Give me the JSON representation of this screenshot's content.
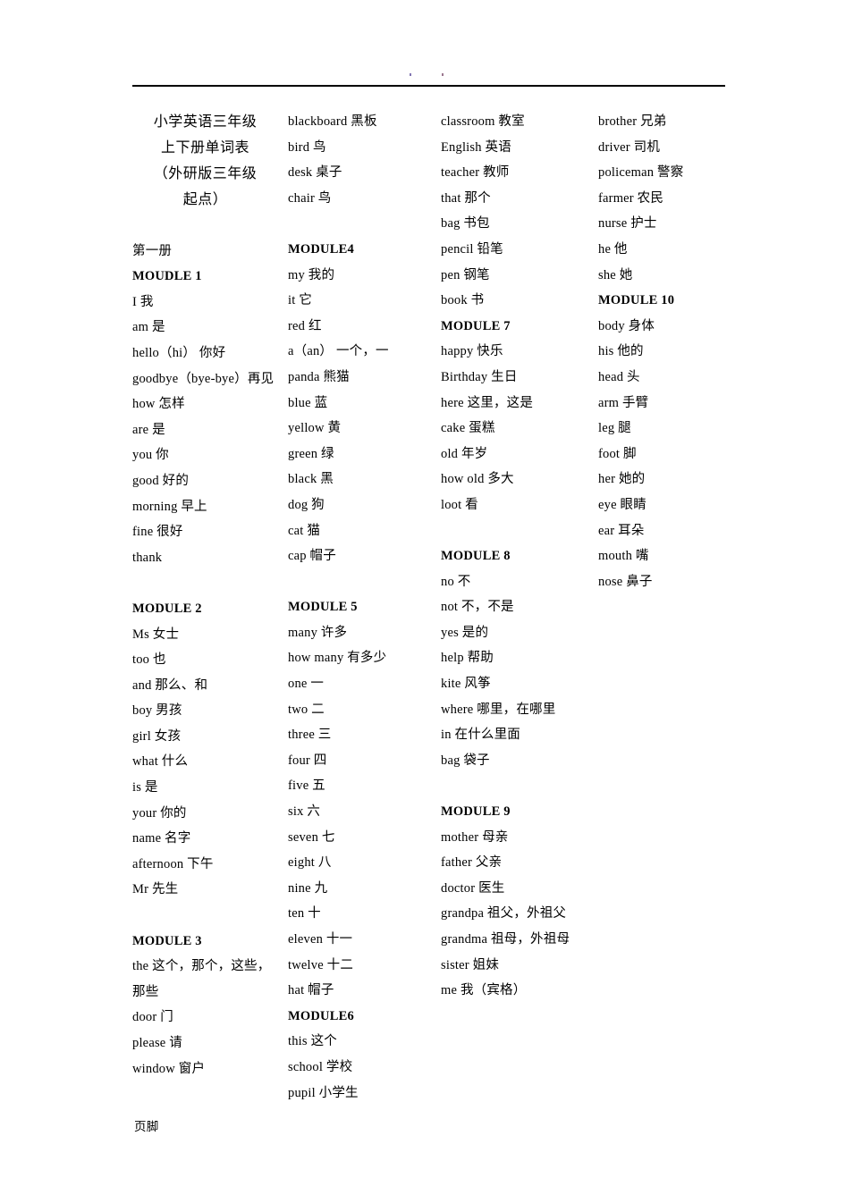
{
  "document": {
    "header": {
      "marks": 2
    },
    "footer_label": "页脚",
    "title_lines": [
      "小学英语三年级",
      "上下册单词表",
      "（外研版三年级",
      "起点）"
    ],
    "volume_label": "第一册"
  },
  "columns": [
    {
      "id": "column-1",
      "blocks": [
        {
          "type": "title"
        },
        {
          "type": "gap"
        },
        {
          "type": "volume"
        },
        {
          "type": "module",
          "label": "MOUDLE 1"
        },
        {
          "type": "entry",
          "text": "I 我"
        },
        {
          "type": "entry",
          "text": "am 是"
        },
        {
          "type": "entry",
          "text": "hello（hi） 你好"
        },
        {
          "type": "entry",
          "text": "goodbye（bye-bye）再见"
        },
        {
          "type": "entry",
          "text": "how 怎样"
        },
        {
          "type": "entry",
          "text": "are 是"
        },
        {
          "type": "entry",
          "text": "you 你"
        },
        {
          "type": "entry",
          "text": "good 好的"
        },
        {
          "type": "entry",
          "text": "morning 早上"
        },
        {
          "type": "entry",
          "text": "fine 很好"
        },
        {
          "type": "entry",
          "text": "thank"
        },
        {
          "type": "gap"
        },
        {
          "type": "module",
          "label": "MODULE 2"
        },
        {
          "type": "entry",
          "text": "Ms 女士"
        },
        {
          "type": "entry",
          "text": "too 也"
        },
        {
          "type": "entry",
          "text": "and 那么、和"
        },
        {
          "type": "entry",
          "text": "boy 男孩"
        },
        {
          "type": "entry",
          "text": "girl 女孩"
        },
        {
          "type": "entry",
          "text": "what 什么"
        },
        {
          "type": "entry",
          "text": "is 是"
        },
        {
          "type": "entry",
          "text": "your 你的"
        },
        {
          "type": "entry",
          "text": "name 名字"
        },
        {
          "type": "entry",
          "text": "afternoon 下午"
        },
        {
          "type": "entry",
          "text": "Mr 先生"
        },
        {
          "type": "gap"
        },
        {
          "type": "module",
          "label": "MODULE 3"
        },
        {
          "type": "entry",
          "text": "the 这个，那个，这些，那些"
        },
        {
          "type": "entry",
          "text": "door 门"
        },
        {
          "type": "entry",
          "text": "please 请"
        },
        {
          "type": "entry",
          "text": "window 窗户"
        }
      ]
    },
    {
      "id": "column-2",
      "blocks": [
        {
          "type": "entry",
          "text": "blackboard 黑板"
        },
        {
          "type": "entry",
          "text": "bird 鸟"
        },
        {
          "type": "entry",
          "text": "desk 桌子"
        },
        {
          "type": "entry",
          "text": "chair 鸟"
        },
        {
          "type": "gap"
        },
        {
          "type": "module",
          "label": "MODULE4"
        },
        {
          "type": "entry",
          "text": "my 我的"
        },
        {
          "type": "entry",
          "text": "it 它"
        },
        {
          "type": "entry",
          "text": "red 红"
        },
        {
          "type": "entry",
          "text": "a（an） 一个，一"
        },
        {
          "type": "entry",
          "text": "panda 熊猫"
        },
        {
          "type": "entry",
          "text": "blue 蓝"
        },
        {
          "type": "entry",
          "text": "yellow 黄"
        },
        {
          "type": "entry",
          "text": "green 绿"
        },
        {
          "type": "entry",
          "text": "black 黑"
        },
        {
          "type": "entry",
          "text": "dog 狗"
        },
        {
          "type": "entry",
          "text": "cat 猫"
        },
        {
          "type": "entry",
          "text": "cap 帽子"
        },
        {
          "type": "gap"
        },
        {
          "type": "module",
          "label": "MODULE 5"
        },
        {
          "type": "entry",
          "text": "many 许多"
        },
        {
          "type": "entry",
          "text": "how many 有多少"
        },
        {
          "type": "entry",
          "text": "one 一"
        },
        {
          "type": "entry",
          "text": "two 二"
        },
        {
          "type": "entry",
          "text": "three 三"
        },
        {
          "type": "entry",
          "text": "four 四"
        },
        {
          "type": "entry",
          "text": "five 五"
        },
        {
          "type": "entry",
          "text": "six 六"
        },
        {
          "type": "entry",
          "text": "seven 七"
        },
        {
          "type": "entry",
          "text": "eight 八"
        },
        {
          "type": "entry",
          "text": "nine 九"
        },
        {
          "type": "entry",
          "text": "ten 十"
        },
        {
          "type": "entry",
          "text": "eleven 十一"
        },
        {
          "type": "entry",
          "text": "twelve 十二"
        },
        {
          "type": "entry",
          "text": "hat 帽子"
        },
        {
          "type": "module",
          "label": "MODULE6"
        },
        {
          "type": "entry",
          "text": "this 这个"
        },
        {
          "type": "entry",
          "text": "school 学校"
        },
        {
          "type": "entry",
          "text": "pupil 小学生"
        }
      ]
    },
    {
      "id": "column-3",
      "blocks": [
        {
          "type": "entry",
          "text": "classroom 教室"
        },
        {
          "type": "entry",
          "text": "English 英语"
        },
        {
          "type": "entry",
          "text": "teacher 教师"
        },
        {
          "type": "entry",
          "text": "that 那个"
        },
        {
          "type": "entry",
          "text": "bag 书包"
        },
        {
          "type": "entry",
          "text": "pencil 铅笔"
        },
        {
          "type": "entry",
          "text": "pen 钢笔"
        },
        {
          "type": "entry",
          "text": "book 书"
        },
        {
          "type": "module",
          "label": "MODULE 7"
        },
        {
          "type": "entry",
          "text": "happy 快乐"
        },
        {
          "type": "entry",
          "text": "Birthday 生日"
        },
        {
          "type": "entry",
          "text": "here 这里，这是"
        },
        {
          "type": "entry",
          "text": "cake 蛋糕"
        },
        {
          "type": "entry",
          "text": "old 年岁"
        },
        {
          "type": "entry",
          "text": "how old 多大"
        },
        {
          "type": "entry",
          "text": "loot 看"
        },
        {
          "type": "gap"
        },
        {
          "type": "module",
          "label": "MODULE 8"
        },
        {
          "type": "entry",
          "text": "no 不"
        },
        {
          "type": "entry",
          "text": "not 不，不是"
        },
        {
          "type": "entry",
          "text": "yes 是的"
        },
        {
          "type": "entry",
          "text": "help 帮助"
        },
        {
          "type": "entry",
          "text": "kite 风筝"
        },
        {
          "type": "entry",
          "text": "where 哪里，在哪里"
        },
        {
          "type": "entry",
          "text": "in 在什么里面"
        },
        {
          "type": "entry",
          "text": "bag 袋子"
        },
        {
          "type": "gap"
        },
        {
          "type": "module",
          "label": "MODULE 9"
        },
        {
          "type": "entry",
          "text": "mother 母亲"
        },
        {
          "type": "entry",
          "text": "father 父亲"
        },
        {
          "type": "entry",
          "text": "doctor 医生"
        },
        {
          "type": "entry",
          "text": "grandpa 祖父，外祖父"
        },
        {
          "type": "entry",
          "text": "grandma 祖母，外祖母"
        },
        {
          "type": "entry",
          "text": "sister 姐妹"
        },
        {
          "type": "entry",
          "text": "me 我（宾格）"
        }
      ]
    },
    {
      "id": "column-4",
      "blocks": [
        {
          "type": "entry",
          "text": "brother 兄弟"
        },
        {
          "type": "entry",
          "text": "driver 司机"
        },
        {
          "type": "entry",
          "text": "policeman 警察"
        },
        {
          "type": "entry",
          "text": "farmer 农民"
        },
        {
          "type": "entry",
          "text": "nurse 护士"
        },
        {
          "type": "entry",
          "text": "he 他"
        },
        {
          "type": "entry",
          "text": "she 她"
        },
        {
          "type": "module",
          "label": "MODULE 10"
        },
        {
          "type": "entry",
          "text": "body 身体"
        },
        {
          "type": "entry",
          "text": "his 他的"
        },
        {
          "type": "entry",
          "text": "head 头"
        },
        {
          "type": "entry",
          "text": "arm 手臂"
        },
        {
          "type": "entry",
          "text": "leg 腿"
        },
        {
          "type": "entry",
          "text": "foot 脚"
        },
        {
          "type": "entry",
          "text": "her 她的"
        },
        {
          "type": "entry",
          "text": "eye 眼睛"
        },
        {
          "type": "entry",
          "text": "ear 耳朵"
        },
        {
          "type": "entry",
          "text": "mouth 嘴"
        },
        {
          "type": "entry",
          "text": "nose 鼻子"
        }
      ]
    }
  ]
}
